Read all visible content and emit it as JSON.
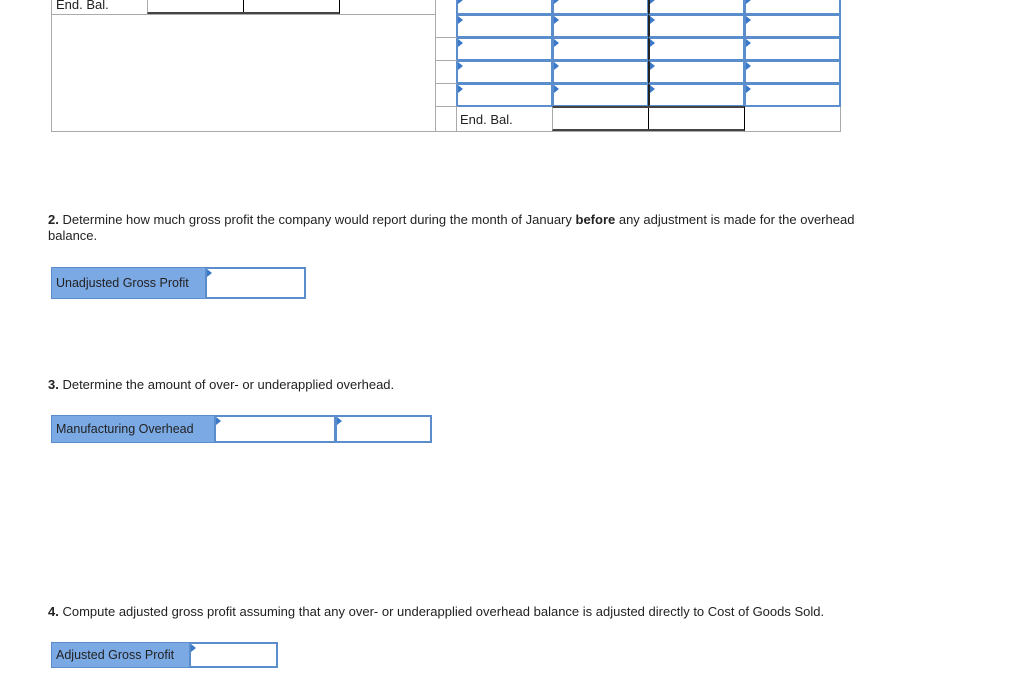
{
  "t_account": {
    "end_bal_left": "End. Bal.",
    "end_bal_right": "End. Bal."
  },
  "q2": {
    "num": "2.",
    "text_a": " Determine how much gross profit the company would report during the month of January ",
    "bold": "before",
    "text_b": " any adjustment is made for the overhead balance.",
    "label": "Unadjusted Gross Profit",
    "value": ""
  },
  "q3": {
    "num": "3.",
    "text": " Determine the amount of over- or underapplied overhead.",
    "label": "Manufacturing Overhead",
    "value1": "",
    "value2": ""
  },
  "q4": {
    "num": "4.",
    "text": " Compute adjusted gross profit assuming that any over- or underapplied overhead balance is adjusted directly to Cost of Goods Sold.",
    "label": "Adjusted Gross Profit",
    "value": ""
  },
  "colors": {
    "accent": "#7ba9e4",
    "input_border": "#5b8ccc"
  }
}
